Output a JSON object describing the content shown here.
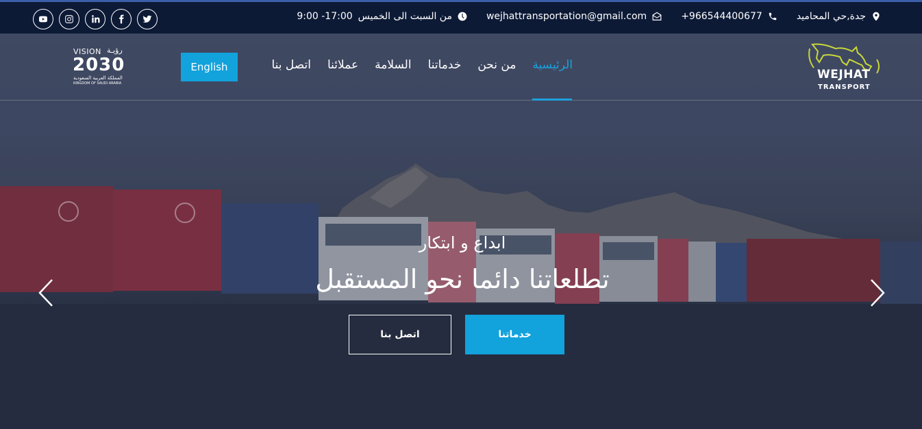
{
  "topbar": {
    "social": [
      {
        "name": "youtube-icon"
      },
      {
        "name": "instagram-icon"
      },
      {
        "name": "linkedin-icon"
      },
      {
        "name": "facebook-icon"
      },
      {
        "name": "twitter-icon"
      }
    ],
    "address": "جدة,حي المحاميد",
    "phone": "+966544400677",
    "email": "wejhattransportation@gmail.com",
    "hours_days": "من السبت الى الخميس",
    "hours_time": "9:00 -17:00"
  },
  "header": {
    "logo_line1": "WEJHAT",
    "logo_line2": "TRANSPORT",
    "nav": {
      "home": "الرئيسية",
      "about": "من نحن",
      "services": "خدماتنا",
      "safety": "السلامة",
      "clients": "عملائنا",
      "contact": "اتصل بنا"
    },
    "lang_button": "English",
    "vision": {
      "en": "VISION",
      "ar": "رؤيـة",
      "year": "2030",
      "kingdom_ar": "المملكة العربية السعودية",
      "kingdom_en": "KINGDOM OF SAUDI ARABIA"
    }
  },
  "hero": {
    "subtitle": "ابداع و ابتكار",
    "title": "تطلعاتنا دائما نحو المستقبل",
    "services_button": "خدماتنا",
    "contact_button": "اتصل بنا"
  },
  "colors": {
    "accent": "#12a2dc",
    "topbar": "#0d1a36"
  }
}
